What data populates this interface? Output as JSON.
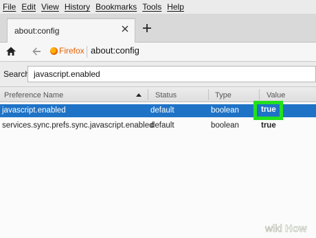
{
  "menu": [
    "File",
    "Edit",
    "View",
    "History",
    "Bookmarks",
    "Tools",
    "Help"
  ],
  "tab": {
    "title": "about:config"
  },
  "nav": {
    "identity": "Firefox",
    "url": "about:config"
  },
  "search": {
    "label": "Search:",
    "value": "javascript.enabled"
  },
  "table": {
    "headers": [
      "Preference Name",
      "Status",
      "Type",
      "Value"
    ],
    "rows": [
      {
        "name": "javascript.enabled",
        "status": "default",
        "type": "boolean",
        "value": "true",
        "selected": true
      },
      {
        "name": "services.sync.prefs.sync.javascript.enabled",
        "status": "default",
        "type": "boolean",
        "value": "true",
        "selected": false
      }
    ]
  },
  "highlight_color": "#22e01e",
  "selection_color": "#1f73c6",
  "watermark": "wikiHow"
}
